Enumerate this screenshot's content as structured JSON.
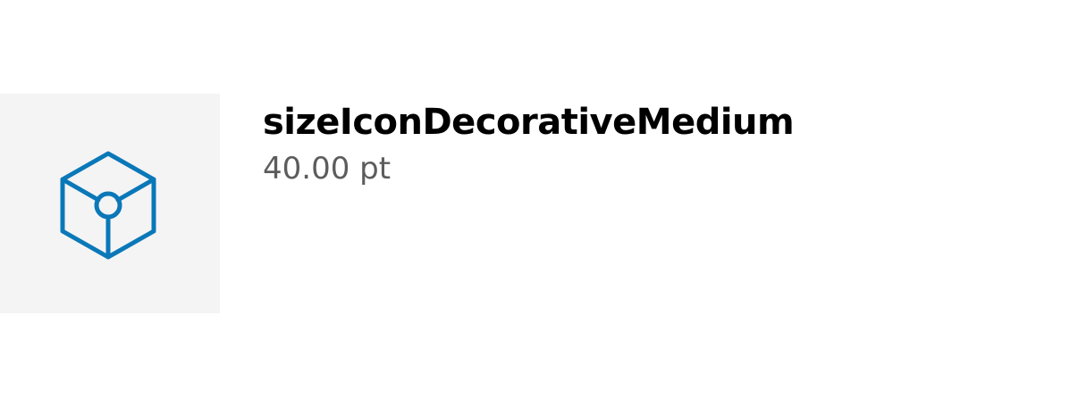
{
  "token": {
    "name": "sizeIconDecorativeMedium",
    "value": "40.00 pt",
    "icon": "cube-icon",
    "icon_color": "#0a78b8",
    "tile_color": "#f4f4f4"
  }
}
